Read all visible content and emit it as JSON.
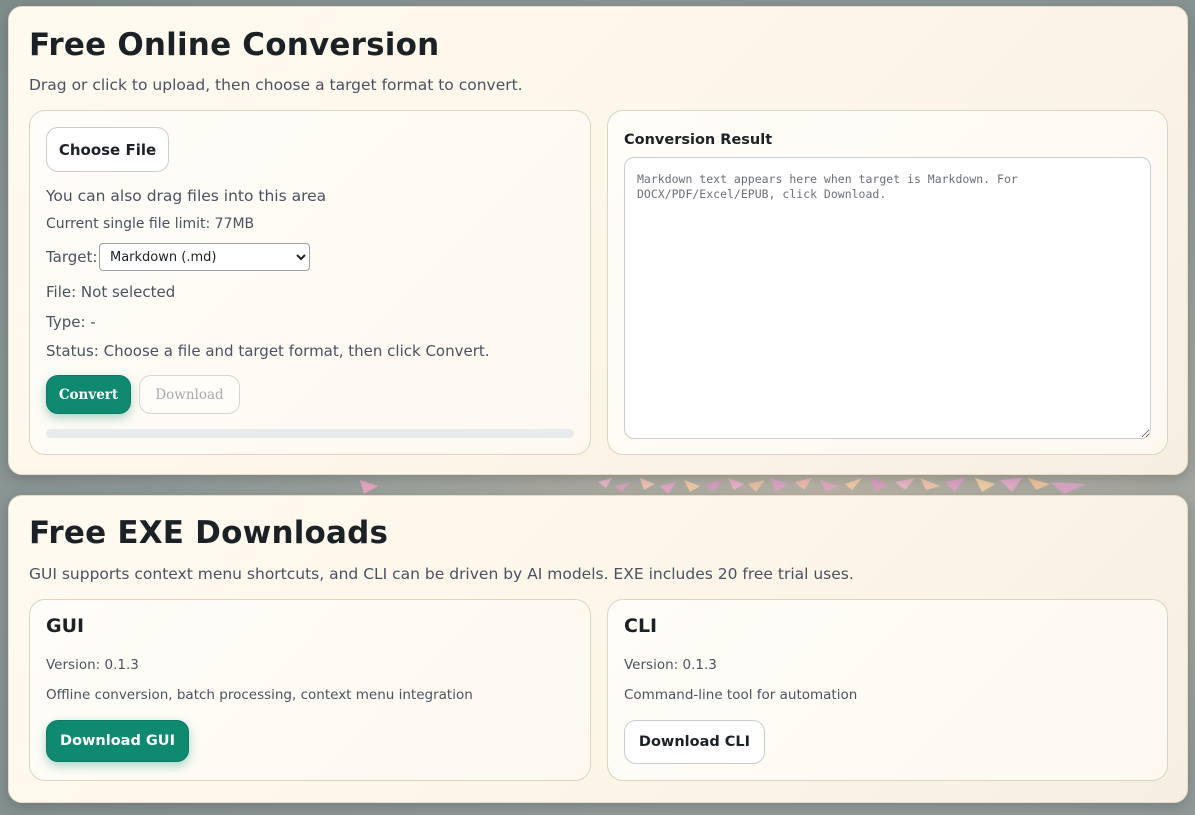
{
  "conversion": {
    "title": "Free Online Conversion",
    "subtitle": "Drag or click to upload, then choose a target format to convert.",
    "choose_file_label": "Choose File",
    "drag_hint": "You can also drag files into this area",
    "file_limit": "Current single file limit: 77MB",
    "target_label": "Target:",
    "target_selected": "Markdown (.md)",
    "file_status": "File: Not selected",
    "type_status": "Type: -",
    "status": "Status: Choose a file and target format, then click Convert.",
    "convert_label": "Convert",
    "download_label": "Download",
    "progress": 0,
    "result_title": "Conversion Result",
    "result_placeholder": "Markdown text appears here when target is Markdown. For DOCX/PDF/Excel/EPUB, click Download."
  },
  "downloads": {
    "title": "Free EXE Downloads",
    "subtitle": "GUI supports context menu shortcuts, and CLI can be driven by AI models. EXE includes 20 free trial uses.",
    "gui": {
      "name": "GUI",
      "version": "Version: 0.1.3",
      "description": "Offline conversion, batch processing, context menu integration",
      "button": "Download GUI"
    },
    "cli": {
      "name": "CLI",
      "version": "Version: 0.1.3",
      "description": "Command-line tool for automation",
      "button": "Download CLI"
    }
  },
  "colors": {
    "accent": "#0f8a70",
    "panel_bg": "#fdf7ea",
    "text_dark": "#1c2126",
    "text_muted": "#4a5260"
  }
}
